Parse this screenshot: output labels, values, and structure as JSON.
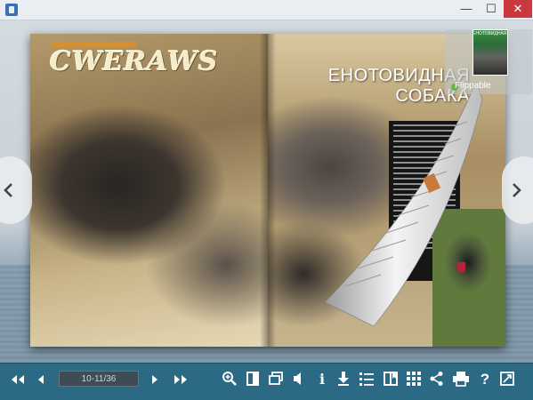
{
  "window": {
    "title": "",
    "controls": {
      "minimize": "—",
      "maximize": "☐",
      "close": "✕"
    }
  },
  "book": {
    "magazine_logo": "CWERAWS",
    "article_title_line1": "ЕНОТОВИДНАЯ",
    "article_title_line2": "СОБАКА",
    "current_page": "10-11/36",
    "corner_thumbnail_label": "ЕНОТОВИДНАЯ",
    "brand_label": "Flippable"
  },
  "navigation": {
    "prev_arrow": "‹",
    "next_arrow": "›"
  },
  "toolbar": {
    "buttons": [
      {
        "name": "first-page-button",
        "icon": "double-left-arrow-icon",
        "glyph": "◀◀"
      },
      {
        "name": "prev-page-button",
        "icon": "left-arrow-icon",
        "glyph": "◀"
      },
      {
        "name": "next-page-button",
        "icon": "right-arrow-icon",
        "glyph": "▶"
      },
      {
        "name": "last-page-button",
        "icon": "double-right-arrow-icon",
        "glyph": "▶▶"
      },
      {
        "name": "zoom-button",
        "icon": "zoom-icon"
      },
      {
        "name": "single-page-button",
        "icon": "single-page-icon"
      },
      {
        "name": "fullscreen-window-button",
        "icon": "window-icon"
      },
      {
        "name": "sound-button",
        "icon": "speaker-icon"
      },
      {
        "name": "info-button",
        "icon": "info-icon",
        "glyph": "i"
      },
      {
        "name": "download-button",
        "icon": "download-icon"
      },
      {
        "name": "table-of-contents-button",
        "icon": "list-icon"
      },
      {
        "name": "bookmark-button",
        "icon": "bookmark-icon"
      },
      {
        "name": "thumbnails-button",
        "icon": "grid-icon"
      },
      {
        "name": "share-button",
        "icon": "share-icon"
      },
      {
        "name": "print-button",
        "icon": "print-icon"
      },
      {
        "name": "help-button",
        "icon": "help-icon",
        "glyph": "?"
      },
      {
        "name": "expand-button",
        "icon": "expand-icon"
      }
    ]
  },
  "colors": {
    "toolbar": "#2b6984",
    "page_field": "#3f4c55",
    "accent_brand": "#6ab443"
  }
}
